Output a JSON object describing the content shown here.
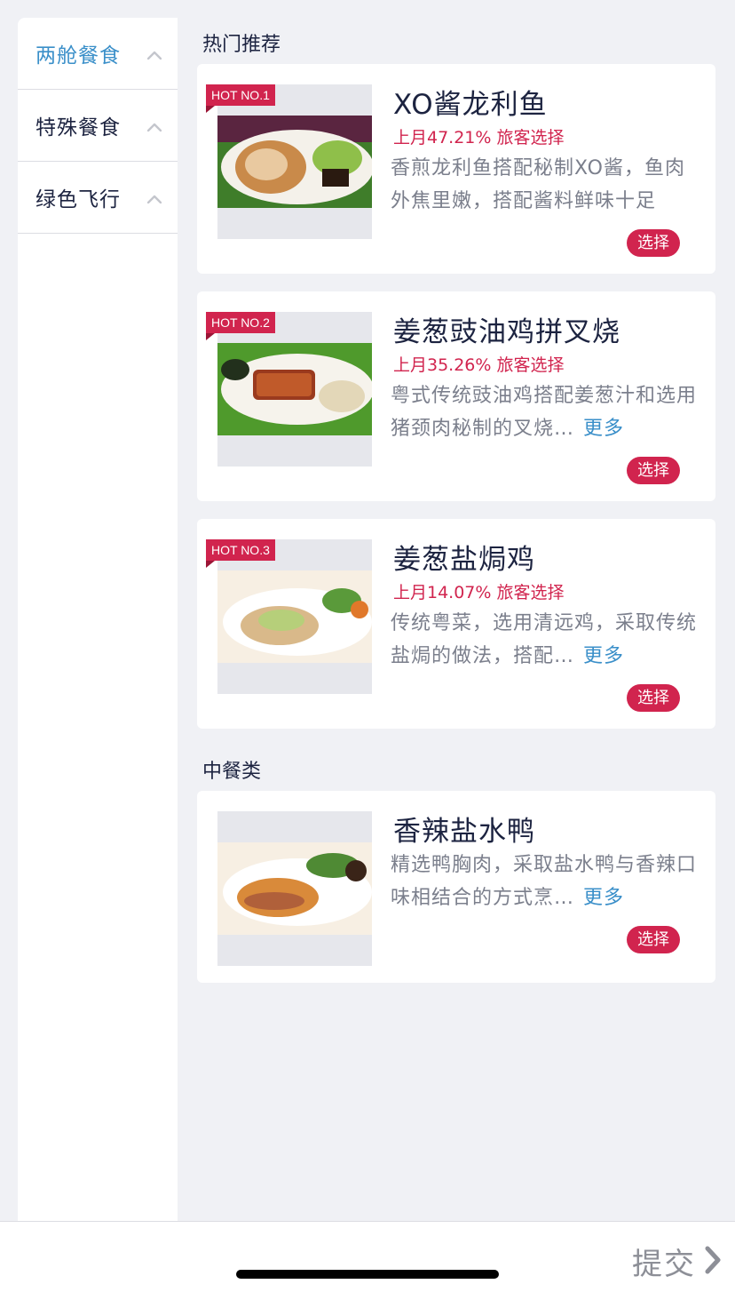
{
  "sidebar": {
    "items": [
      {
        "label": "两舱餐食",
        "active": true
      },
      {
        "label": "特殊餐食",
        "active": false
      },
      {
        "label": "绿色飞行",
        "active": false
      }
    ]
  },
  "sections": {
    "hot_title": "热门推荐",
    "chinese_title": "中餐类"
  },
  "dishes": [
    {
      "badge": "HOT NO.1",
      "name": "XO酱龙利鱼",
      "pct": "上月47.21% 旅客选择",
      "desc": "香煎龙利鱼搭配秘制XO酱，鱼肉外焦里嫩，搭配酱料鲜味十足",
      "more": "",
      "select": "选择"
    },
    {
      "badge": "HOT NO.2",
      "name": "姜葱豉油鸡拼叉烧",
      "pct": "上月35.26% 旅客选择",
      "desc": "粤式传统豉油鸡搭配姜葱汁和选用猪颈肉秘制的叉烧…",
      "more": "更多",
      "select": "选择"
    },
    {
      "badge": "HOT NO.3",
      "name": "姜葱盐焗鸡",
      "pct": "上月14.07% 旅客选择",
      "desc": "传统粤菜，选用清远鸡，采取传统盐焗的做法，搭配…",
      "more": "更多",
      "select": "选择"
    },
    {
      "badge": "",
      "name": "香辣盐水鸭",
      "pct": "",
      "desc": "精选鸭胸肉，采取盐水鸭与香辣口味相结合的方式烹…",
      "more": "更多",
      "select": "选择"
    }
  ],
  "footer": {
    "submit": "提交"
  },
  "colors": {
    "accent_red": "#d1244e",
    "link_blue": "#3a8fc9",
    "page_bg": "#f0f1f5"
  }
}
